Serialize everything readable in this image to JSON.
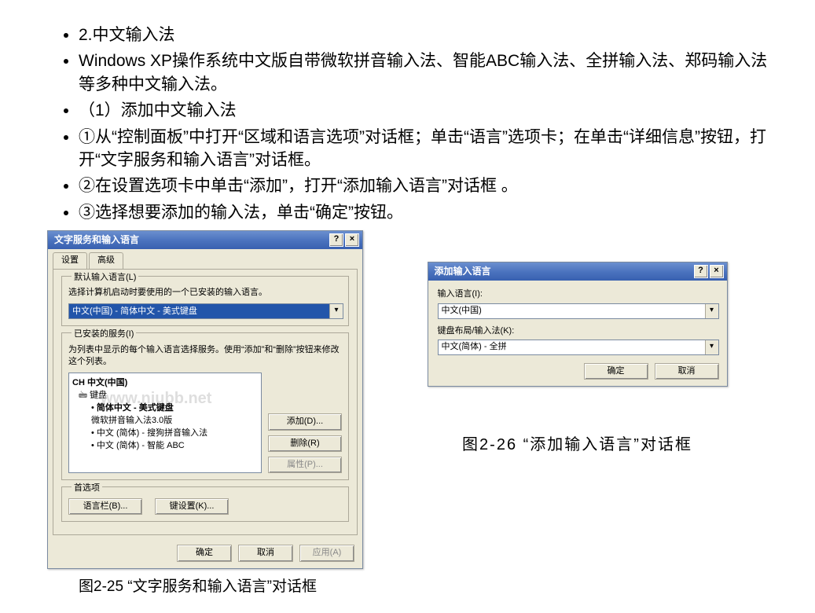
{
  "bullets": [
    "2.中文输入法",
    "   Windows XP操作系统中文版自带微软拼音输入法、智能ABC输入法、全拼输入法、郑码输入法等多种中文输入法。",
    "（1）添加中文输入法",
    "①从“控制面板”中打开“区域和语言选项”对话框；单击“语言”选项卡；在单击“详细信息”按钮，打开“文字服务和输入语言”对话框。",
    "②在设置选项卡中单击“添加”，打开“添加输入语言”对话框 。",
    "③选择想要添加的输入法，单击“确定”按钮。"
  ],
  "dialog1": {
    "title": "文字服务和输入语言",
    "tabs": [
      "设置",
      "高级"
    ],
    "group_default_title": "默认输入语言(L)",
    "default_hint": "选择计算机启动时要使用的一个已安装的输入语言。",
    "default_value": "中文(中国) - 简体中文 - 美式键盘",
    "group_installed_title": "已安装的服务(I)",
    "installed_hint": "为列表中显示的每个输入语言选择服务。使用“添加”和“删除”按钮来修改这个列表。",
    "tree_root": "CH 中文(中国)",
    "tree_keyboard": "键盘",
    "tree_items": [
      "简体中文 - 美式键盘",
      "微软拼音输入法3.0版",
      "中文 (简体) - 搜狗拼音输入法",
      "中文 (简体) - 智能 ABC"
    ],
    "btn_add": "添加(D)...",
    "btn_remove": "删除(R)",
    "btn_props": "属性(P)...",
    "group_prefs": "首选项",
    "btn_langbar": "语言栏(B)...",
    "btn_keyset": "键设置(K)...",
    "btn_ok": "确定",
    "btn_cancel": "取消",
    "btn_apply": "应用(A)"
  },
  "dialog2": {
    "title": "添加输入语言",
    "lbl_lang": "输入语言(I):",
    "val_lang": "中文(中国)",
    "lbl_layout": "键盘布局/输入法(K):",
    "val_layout": "中文(简体) - 全拼",
    "btn_ok": "确定",
    "btn_cancel": "取消"
  },
  "captions": {
    "c25": "图2-25 “文字服务和输入语言”对话框",
    "c26": "图2-26  “添加输入语言”对话框"
  },
  "watermark": "www.niubb.net"
}
